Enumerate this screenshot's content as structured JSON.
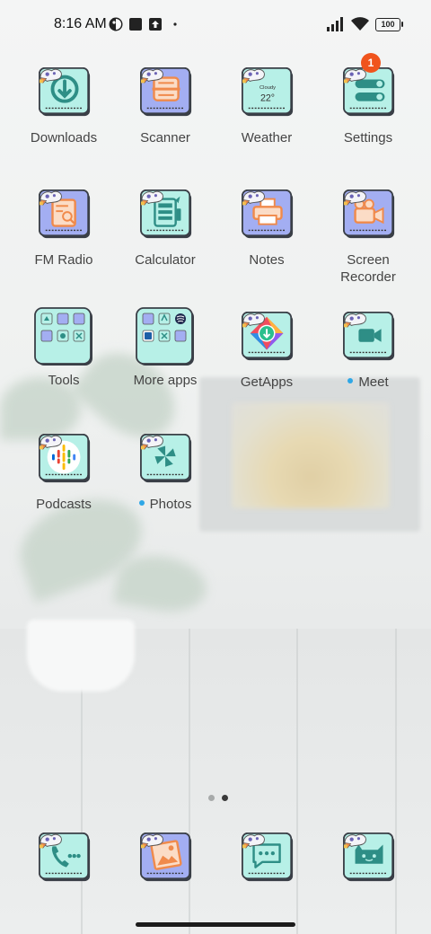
{
  "status_bar": {
    "time": "8:16 AM",
    "battery": "100",
    "icons": [
      "theme-icon",
      "square-app-icon",
      "upload-icon",
      "more-dot-icon",
      "signal-icon",
      "wifi-icon",
      "battery-icon"
    ]
  },
  "apps": [
    {
      "label": "Downloads",
      "icon": "download-icon",
      "bg": "#b7f0e7"
    },
    {
      "label": "Scanner",
      "icon": "scanner-icon",
      "bg": "#a3aef2"
    },
    {
      "label": "Weather",
      "icon": "weather-icon",
      "bg": "#b7f0e7",
      "widget_text": "Cloudy",
      "widget_temp": "22°"
    },
    {
      "label": "Settings",
      "icon": "settings-icon",
      "bg": "#b7f0e7",
      "badge": "1"
    },
    {
      "label": "FM Radio",
      "icon": "fm-radio-icon",
      "bg": "#a3aef2"
    },
    {
      "label": "Calculator",
      "icon": "calculator-icon",
      "bg": "#b7f0e7"
    },
    {
      "label": "Notes",
      "icon": "notes-icon",
      "bg": "#a3aef2"
    },
    {
      "label": "Screen Recorder",
      "icon": "screen-recorder-icon",
      "bg": "#a3aef2"
    },
    {
      "label": "Tools",
      "icon": "tools-folder-icon",
      "bg": "#b7f0e7"
    },
    {
      "label": "More apps",
      "icon": "more-apps-folder-icon",
      "bg": "#b7f0e7"
    },
    {
      "label": "GetApps",
      "icon": "getapps-icon",
      "bg": "#b7f0e7"
    },
    {
      "label": "Meet",
      "icon": "meet-icon",
      "bg": "#b7f0e7",
      "new_dot": true
    },
    {
      "label": "Podcasts",
      "icon": "podcasts-icon",
      "bg": "#b7f0e7"
    },
    {
      "label": "Photos",
      "icon": "photos-icon",
      "bg": "#b7f0e7",
      "new_dot": true
    }
  ],
  "dock": [
    {
      "icon": "phone-icon",
      "bg": "#b7f0e7"
    },
    {
      "icon": "gallery-icon",
      "bg": "#a3aef2"
    },
    {
      "icon": "messages-icon",
      "bg": "#b7f0e7"
    },
    {
      "icon": "camera-icon",
      "bg": "#b7f0e7"
    }
  ],
  "pager": {
    "pages": 2,
    "current": 2
  },
  "colors": {
    "mint_tile": "#b7f0e7",
    "periwinkle_tile": "#a3aef2",
    "icon_teal": "#2e8e86",
    "icon_orange": "#f08a4b",
    "badge": "#f0541d",
    "new_dot": "#2ea7e6"
  }
}
